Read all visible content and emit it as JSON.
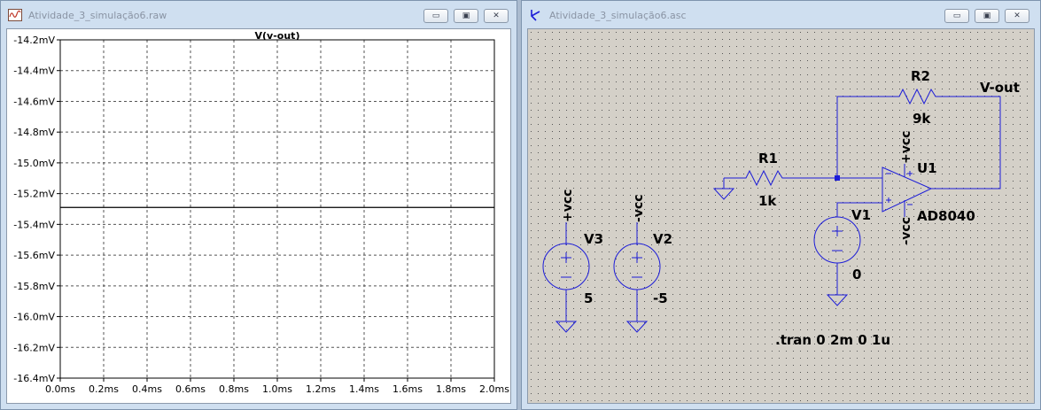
{
  "plot_window": {
    "title": "Atividade_3_simulação6.raw",
    "icon": "waveform-icon",
    "buttons": {
      "minimize": "▭",
      "maximize": "▣",
      "close": "✕"
    }
  },
  "schematic_window": {
    "title": "Atividade_3_simulação6.asc",
    "icon": "schematic-icon",
    "buttons": {
      "minimize": "▭",
      "maximize": "▣",
      "close": "✕"
    }
  },
  "chart_data": {
    "type": "line",
    "title": "V(v-out)",
    "xlabel": "",
    "ylabel": "",
    "xlim": [
      0,
      2
    ],
    "ylim": [
      -16.4,
      -14.2
    ],
    "x_ticks": [
      "0.0ms",
      "0.2ms",
      "0.4ms",
      "0.6ms",
      "0.8ms",
      "1.0ms",
      "1.2ms",
      "1.4ms",
      "1.6ms",
      "1.8ms",
      "2.0ms"
    ],
    "y_ticks": [
      "-14.2mV",
      "-14.4mV",
      "-14.6mV",
      "-14.8mV",
      "-15.0mV",
      "-15.2mV",
      "-15.4mV",
      "-15.6mV",
      "-15.8mV",
      "-16.0mV",
      "-16.2mV",
      "-16.4mV"
    ],
    "grid": true,
    "series": [
      {
        "name": "V(v-out)",
        "x": [
          0,
          2
        ],
        "y": [
          -15.29,
          -15.29
        ],
        "color": "#000000"
      }
    ]
  },
  "schematic": {
    "r2": {
      "name": "R2",
      "value": "9k"
    },
    "r1": {
      "name": "R1",
      "value": "1k"
    },
    "u1": {
      "name": "U1",
      "model": "AD8040"
    },
    "v1": {
      "name": "V1",
      "value": "0"
    },
    "v2": {
      "name": "V2",
      "value": "-5"
    },
    "v3": {
      "name": "V3",
      "value": "5"
    },
    "net_vout": "V-out",
    "net_vcc_pos": "+vcc",
    "net_vcc_neg": "-vcc",
    "directive": ".tran 0 2m 0 1u",
    "wire_color": "#1c1cd8",
    "component_color": "#1c1cd8",
    "text_color": "#000000"
  }
}
